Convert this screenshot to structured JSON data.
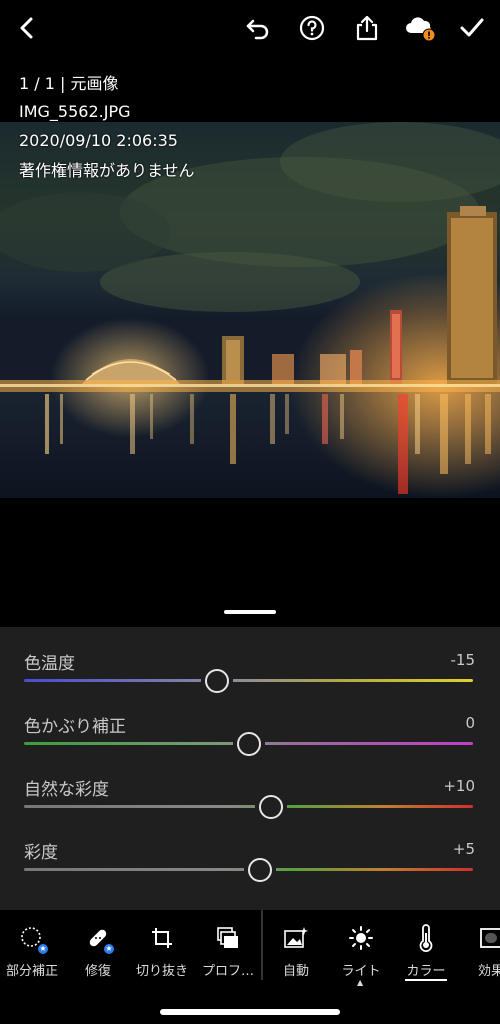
{
  "topbar": {
    "back_icon": "chevron-left-icon",
    "undo_icon": "undo-icon",
    "help_icon": "help-icon",
    "share_icon": "share-icon",
    "cloud_icon": "cloud-sync-warning-icon",
    "done_icon": "checkmark-icon"
  },
  "photo_info": {
    "position": "1 / 1 | 元画像",
    "filename": "IMG_5562.JPG",
    "datetime": "2020/09/10 2:06:35",
    "copyright": "著作権情報がありません"
  },
  "color_panel": {
    "sliders": [
      {
        "label": "色温度",
        "value": "-15",
        "level": 0.43
      },
      {
        "label": "色かぶり補正",
        "value": "0",
        "level": 0.5
      },
      {
        "label": "自然な彩度",
        "value": "+10",
        "level": 0.55
      },
      {
        "label": "彩度",
        "value": "+5",
        "level": 0.525
      }
    ]
  },
  "toolbar": {
    "items": [
      {
        "label": "部分補正",
        "icon": "selective-edit-icon"
      },
      {
        "label": "修復",
        "icon": "healing-bandage-icon"
      },
      {
        "label": "切り抜き",
        "icon": "crop-icon"
      },
      {
        "label": "プロフ…",
        "icon": "profiles-icon"
      },
      {
        "label": "自動",
        "icon": "auto-image-icon"
      },
      {
        "label": "ライト",
        "icon": "sun-icon"
      },
      {
        "label": "カラー",
        "icon": "thermometer-icon"
      },
      {
        "label": "効果",
        "icon": "effects-icon"
      }
    ],
    "active": "カラー"
  },
  "colors": {
    "accent_badge": "#2b7ce9",
    "warning_badge": "#f28c1c",
    "panel_bg": "#1f1f1f"
  }
}
